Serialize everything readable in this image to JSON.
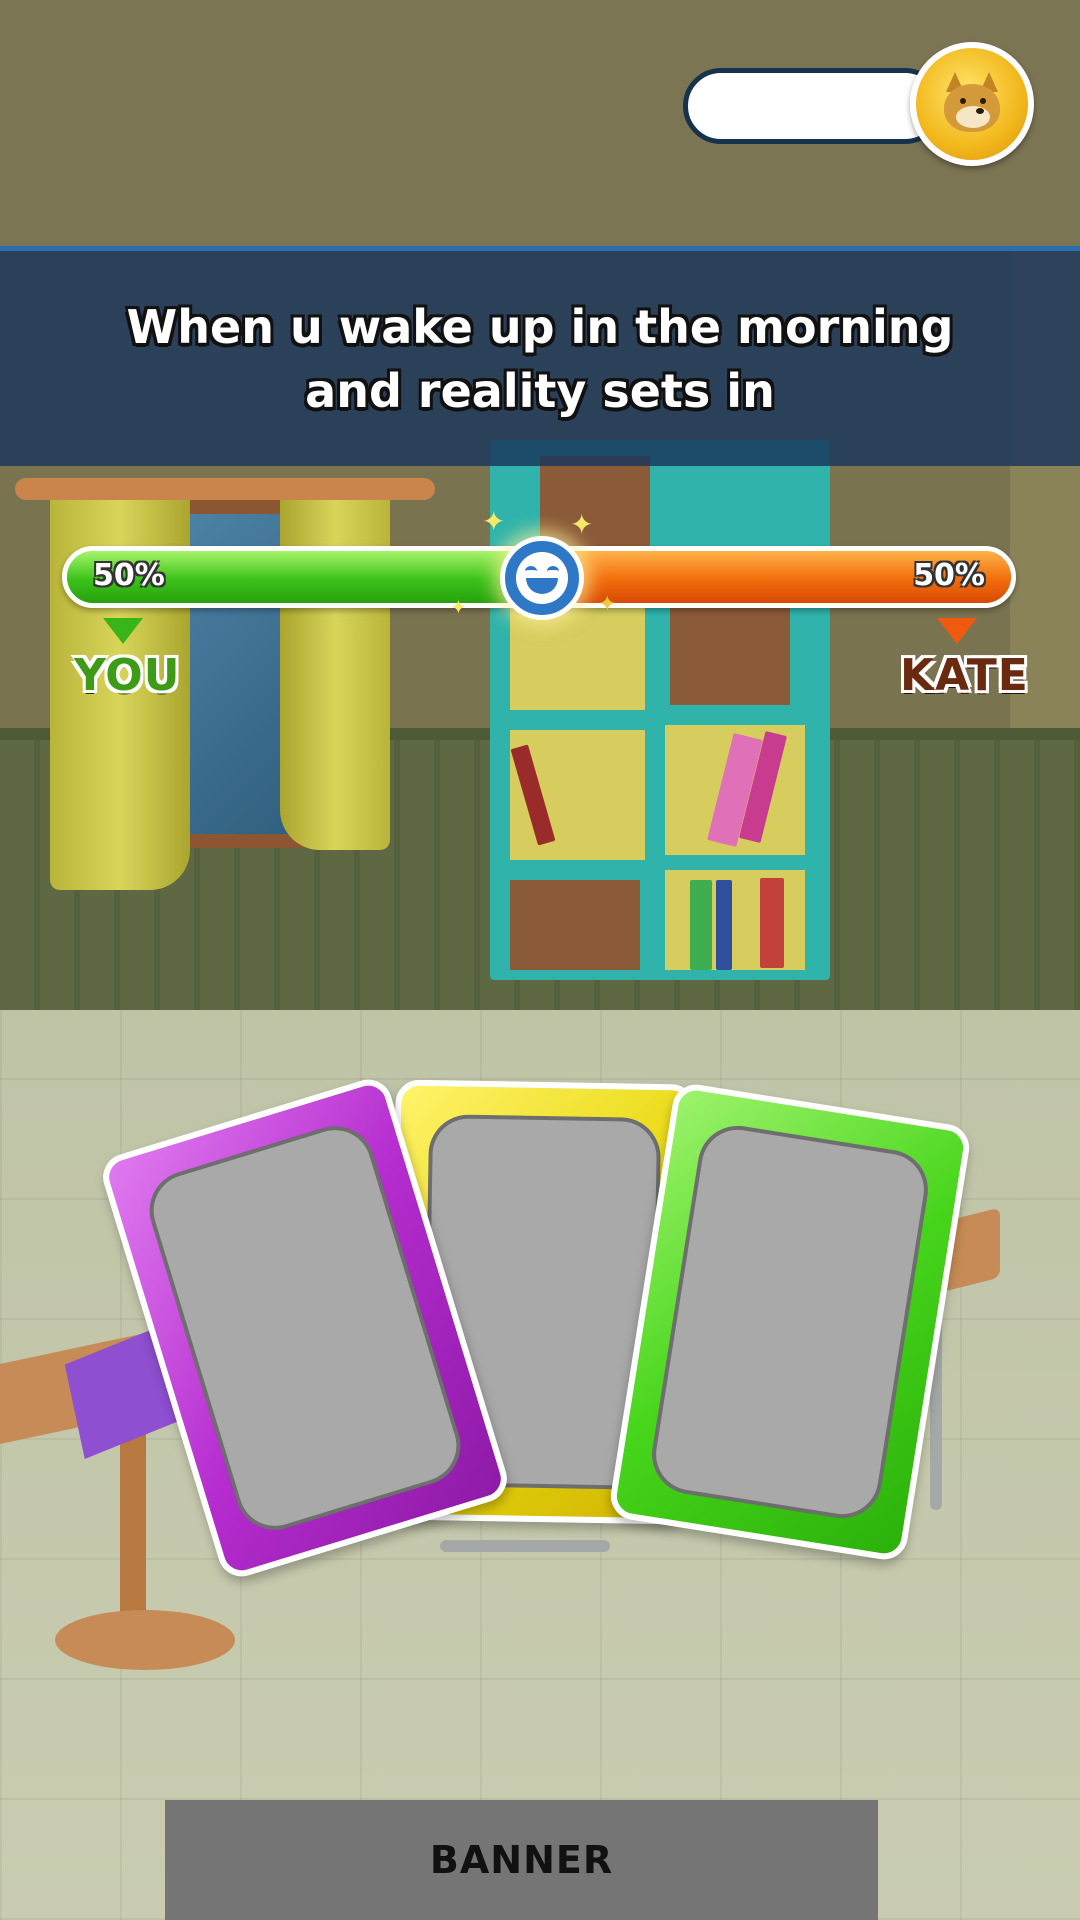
{
  "caption": {
    "line1": "When u wake up in the morning",
    "line2": "and reality sets in"
  },
  "vote": {
    "left_percent": "50%",
    "right_percent": "50%",
    "left_fraction": 0.5,
    "left_color": "#3cc21a",
    "right_color": "#f26d0c"
  },
  "players": {
    "you": "YOU",
    "opponent": "KATE"
  },
  "icons": {
    "coin": "doge-coin-icon",
    "vote_center": "laughing-face-icon"
  },
  "cards": [
    {
      "color": "purple",
      "hex": "#b52ccf"
    },
    {
      "color": "yellow",
      "hex": "#e8d80d"
    },
    {
      "color": "green",
      "hex": "#47d51b"
    }
  ],
  "banner": {
    "label": "BANNER"
  }
}
